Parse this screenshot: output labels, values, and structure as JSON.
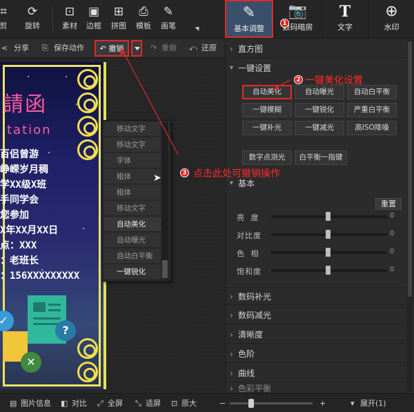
{
  "topbar": {
    "tools": [
      {
        "label": "剪",
        "icon": "crop-icon"
      },
      {
        "label": "旋转",
        "icon": "rotate-icon"
      },
      {
        "label": "素材",
        "icon": "sticker-icon"
      },
      {
        "label": "边框",
        "icon": "frame-icon"
      },
      {
        "label": "拼图",
        "icon": "collage-icon"
      },
      {
        "label": "模板",
        "icon": "template-icon"
      },
      {
        "label": "画笔",
        "icon": "brush-icon"
      }
    ],
    "tabs": [
      {
        "label": "基本调整",
        "icon": "edit-icon"
      },
      {
        "label": "数码暗房",
        "icon": "camera-icon"
      },
      {
        "label": "文字",
        "icon": "text-icon"
      },
      {
        "label": "水印",
        "icon": "watermark-icon"
      }
    ]
  },
  "toolbar2": {
    "share": "分享",
    "save_action": "保存动作",
    "undo": "撤销",
    "redo": "重做",
    "restore": "还原"
  },
  "history": [
    "移动文字",
    "移动文字",
    "字体",
    "粗体",
    "粗体",
    "移动文字",
    "自动美化",
    "自动曝光",
    "自动白平衡",
    "一键锐化"
  ],
  "canvas": {
    "title": "請函",
    "subtitle": "tation",
    "lines": [
      "百侣曾游",
      "峥嵘岁月稠",
      "学XX级X班",
      "手同学会",
      "您参加",
      "X年XX月XX日",
      "点：XXX",
      "：老班长",
      "：156XXXXXXXXX"
    ]
  },
  "panel": {
    "histogram": "直方图",
    "one_click": "一键设置",
    "buttons": [
      [
        "自动美化",
        "自动曝光",
        "自动白平衡"
      ],
      [
        "一键模糊",
        "一键锐化",
        "严重白平衡"
      ],
      [
        "一键补光",
        "一键减光",
        "高ISO降噪"
      ]
    ],
    "buttons2": [
      "数字点测光",
      "白平衡一指键"
    ],
    "basic": "基本",
    "reset": "重置",
    "sliders": [
      {
        "label": "亮  度",
        "value": "0"
      },
      {
        "label": "对比度",
        "value": "0"
      },
      {
        "label": "色  相",
        "value": "0"
      },
      {
        "label": "饱和度",
        "value": "0"
      }
    ],
    "sections": [
      "数码补光",
      "数码减光",
      "清晰度",
      "色阶",
      "曲线",
      "色彩平衡"
    ]
  },
  "statusbar": {
    "info": "图片信息",
    "compare": "对比",
    "fullscreen": "全屏",
    "fit": "适屏",
    "original": "原大",
    "expand": "展开(1)"
  },
  "annotations": {
    "a1": "1",
    "a2": "2",
    "a2_text": "一键美化设置",
    "a3": "3",
    "a3_text": "点击此处可撤销操作"
  },
  "colors": {
    "accent_red": "#e02a2a",
    "panel_bg": "#2b2b2b",
    "selected_tab": "#3a4f6a"
  }
}
